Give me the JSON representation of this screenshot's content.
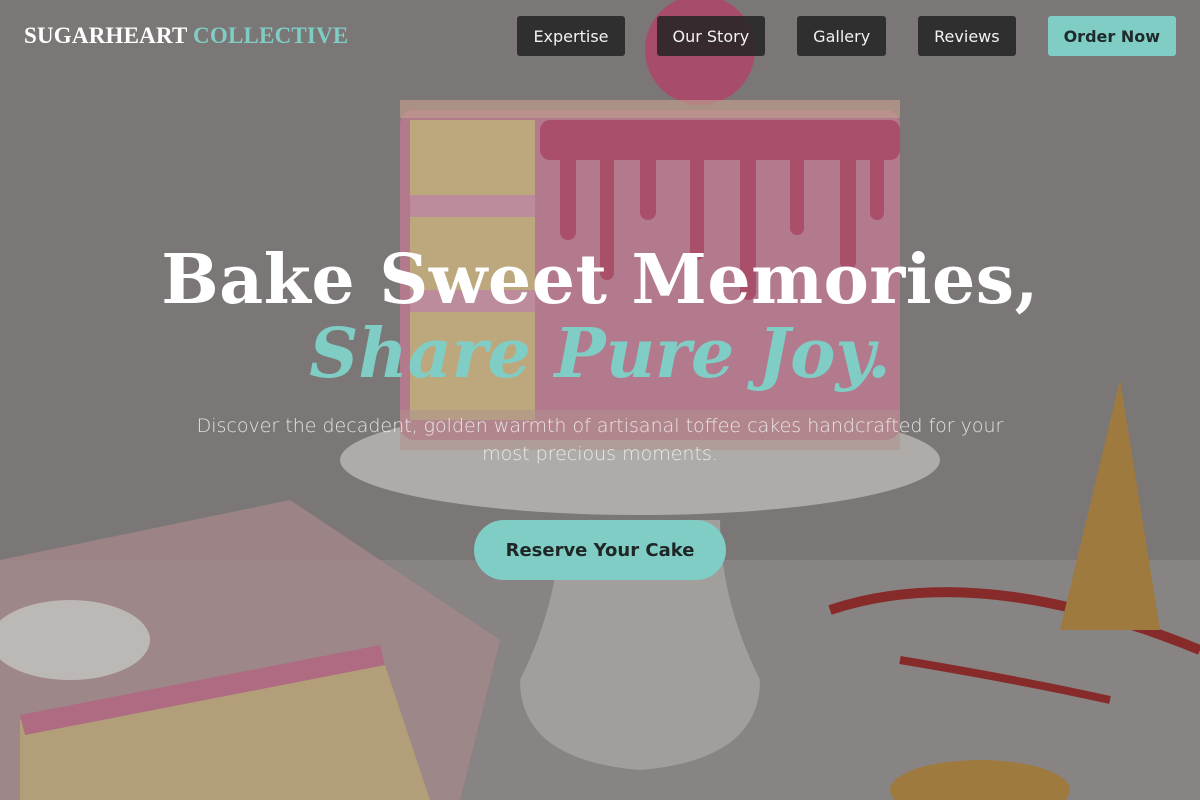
{
  "brand": {
    "primary": "SUGARHEART",
    "accent": "COLLECTIVE"
  },
  "nav": {
    "links": [
      "Expertise",
      "Our Story",
      "Gallery",
      "Reviews"
    ],
    "cta": "Order Now"
  },
  "hero": {
    "headline_line1": "Bake Sweet Memories,",
    "headline_line2": "Share Pure Joy.",
    "subtext": "Discover the decadent, golden warmth of artisanal toffee cakes handcrafted for your most precious moments.",
    "cta": "Reserve Your Cake"
  },
  "colors": {
    "accent": "#7fcdc4",
    "nav_button_bg": "#262626",
    "text_light": "#ffffff"
  },
  "background_image": "cake-photo"
}
